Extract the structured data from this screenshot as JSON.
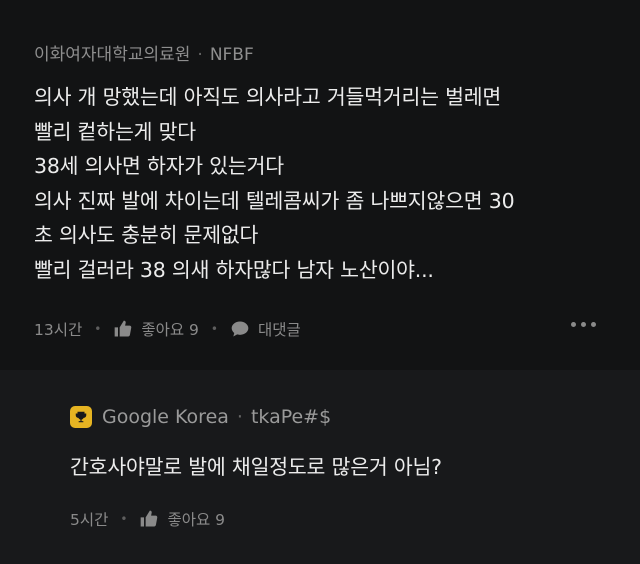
{
  "post": {
    "author": "이화여자대학교의료원",
    "separator": "·",
    "nickname": "NFBF",
    "lines": [
      "의사 개 망했는데 아직도 의사라고 거들먹거리는 벌레면",
      "빨리 컽하는게 맞다",
      "38세 의사면 하자가 있는거다",
      "의사 진짜 발에 차이는데 텔레콤씨가 좀 나쁘지않으면 30",
      "초 의사도 충분히 문제없다",
      "빨리 걸러라 38 의새 하자많다 남자 노산이야..."
    ],
    "time": "13시간",
    "like_label": "좋아요 9",
    "reply_label": "대댓글",
    "more_icon": "more-dots-icon"
  },
  "reply": {
    "author": "Google Korea",
    "separator": "·",
    "nickname": "tkaPe#$",
    "text": "간호사야말로 발에 채일정도로 많은거 아님?",
    "time": "5시간",
    "like_label": "좋아요 9",
    "badge_icon": "trophy-icon"
  },
  "colors": {
    "post_bg": "#121314",
    "reply_bg": "#18191b",
    "badge": "#e6b422"
  }
}
